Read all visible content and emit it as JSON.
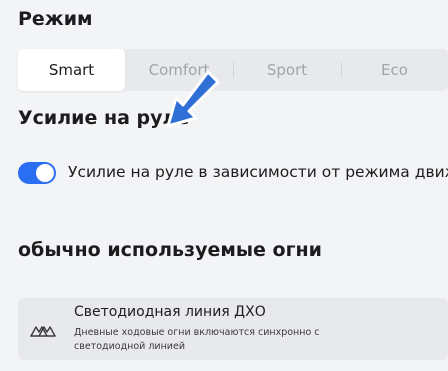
{
  "mode_section": {
    "title": "Режим",
    "options": [
      "Smart",
      "Comfort",
      "Sport",
      "Eco"
    ],
    "selected": "Smart"
  },
  "steering_section": {
    "title": "Усилие на руле",
    "toggle_label": "Усилие на руле в зависимости от режима движ-я",
    "toggle_on": true
  },
  "lights_section": {
    "title": "обычно используемые огни",
    "item": {
      "title": "Светодиодная линия ДХО",
      "description": "Дневные ходовые огни включаются синхронно с светодиодной линией",
      "icon": "daytime-running-lights-icon"
    }
  },
  "colors": {
    "accent": "#2a6ef2",
    "annotation_arrow": "#2f6fd6",
    "background": "#f3f4f6",
    "panel": "#e8e9ec"
  }
}
